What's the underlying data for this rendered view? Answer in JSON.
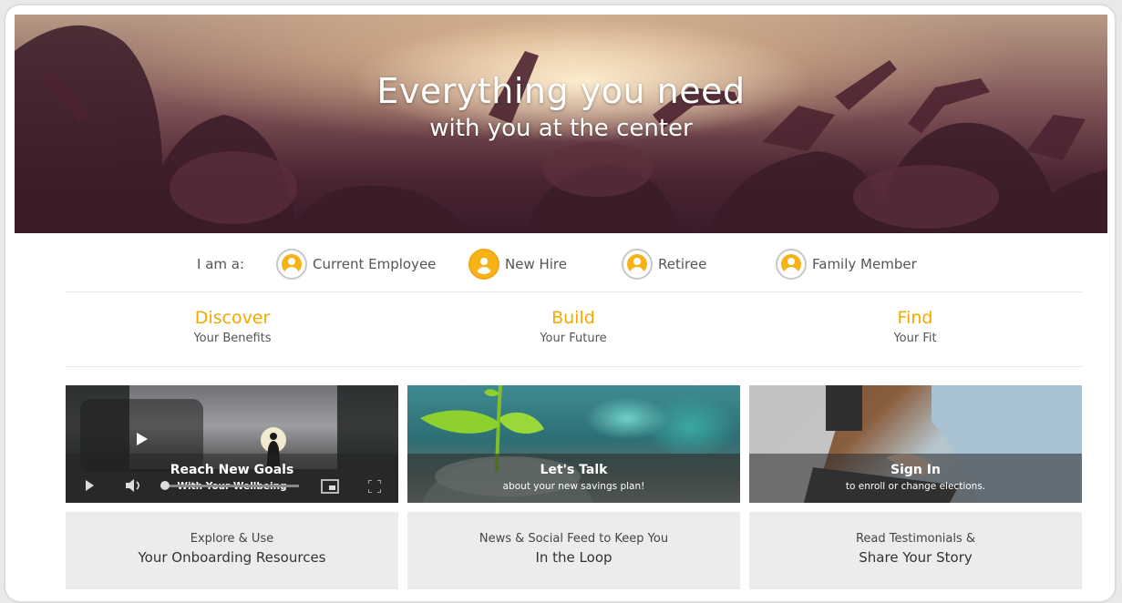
{
  "hero": {
    "title": "Everything you need",
    "subtitle": "with you at the center"
  },
  "roles": {
    "label": "I am a:",
    "items": [
      {
        "label": "Current Employee",
        "icon": "person-icon",
        "active": false
      },
      {
        "label": "New Hire",
        "icon": "person-icon",
        "active": true
      },
      {
        "label": "Retiree",
        "icon": "person-icon",
        "active": false
      },
      {
        "label": "Family Member",
        "icon": "person-icon",
        "active": false
      }
    ]
  },
  "nav": [
    {
      "title": "Discover",
      "subtitle": "Your Benefits"
    },
    {
      "title": "Build",
      "subtitle": "Your Future"
    },
    {
      "title": "Find",
      "subtitle": "Your Fit"
    }
  ],
  "cards": [
    {
      "title": "Reach New Goals",
      "subtitle": "With Your Wellbeing",
      "type": "video"
    },
    {
      "title": "Let's Talk",
      "subtitle": "about your new savings plan!"
    },
    {
      "title": "Sign In",
      "subtitle": "to enroll or change elections."
    }
  ],
  "bottom_cards": [
    {
      "line1": "Explore & Use",
      "line2": "Your Onboarding Resources"
    },
    {
      "line1": "News & Social Feed to Keep You",
      "line2": "In the Loop"
    },
    {
      "line1": "Read Testimonials &",
      "line2": "Share Your Story"
    }
  ],
  "colors": {
    "accent": "#f2a900",
    "avatar": "#f7b316"
  }
}
